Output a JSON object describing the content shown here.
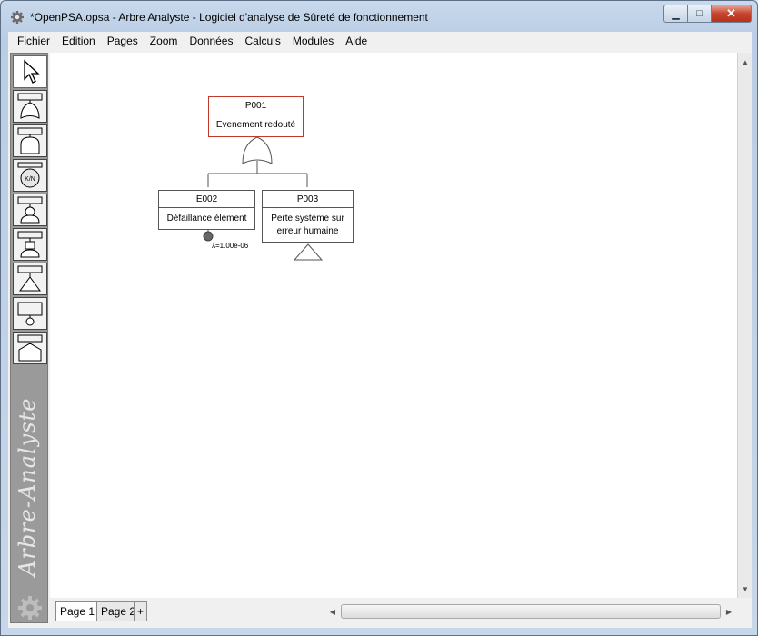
{
  "window": {
    "title": "*OpenPSA.opsa - Arbre Analyste - Logiciel d'analyse de Sûreté de fonctionnement",
    "minimize_glyph": "▁",
    "maximize_glyph": "□",
    "close_glyph": "✕"
  },
  "menu": [
    "Fichier",
    "Edition",
    "Pages",
    "Zoom",
    "Données",
    "Calculs",
    "Modules",
    "Aide"
  ],
  "palette": {
    "tools": [
      "select-pointer-tool",
      "or-gate-tool",
      "and-gate-tool",
      "k-out-of-n-gate-tool",
      "basic-event-tool",
      "house-event-tool",
      "transfer-gate-tool",
      "undeveloped-event-tool",
      "conditioning-event-tool"
    ],
    "kn_label": "K/N",
    "watermark": "Arbre-Analyste"
  },
  "tree": {
    "top": {
      "id": "P001",
      "description": "Evenement redouté",
      "gate": "or"
    },
    "children": [
      {
        "id": "E002",
        "description": "Défaillance élément",
        "type": "basic-event",
        "rate": "λ=1.00e-06"
      },
      {
        "id": "P003",
        "description_lines": [
          "Perte système sur",
          "erreur humaine"
        ],
        "type": "transfer"
      }
    ]
  },
  "tabs": {
    "pages": [
      "Page 1",
      "Page 2"
    ],
    "active": "Page 1",
    "add_label": "+"
  },
  "colors": {
    "gate_border": "#c0392b",
    "node_border": "#555555",
    "canvas": "#ffffff"
  }
}
